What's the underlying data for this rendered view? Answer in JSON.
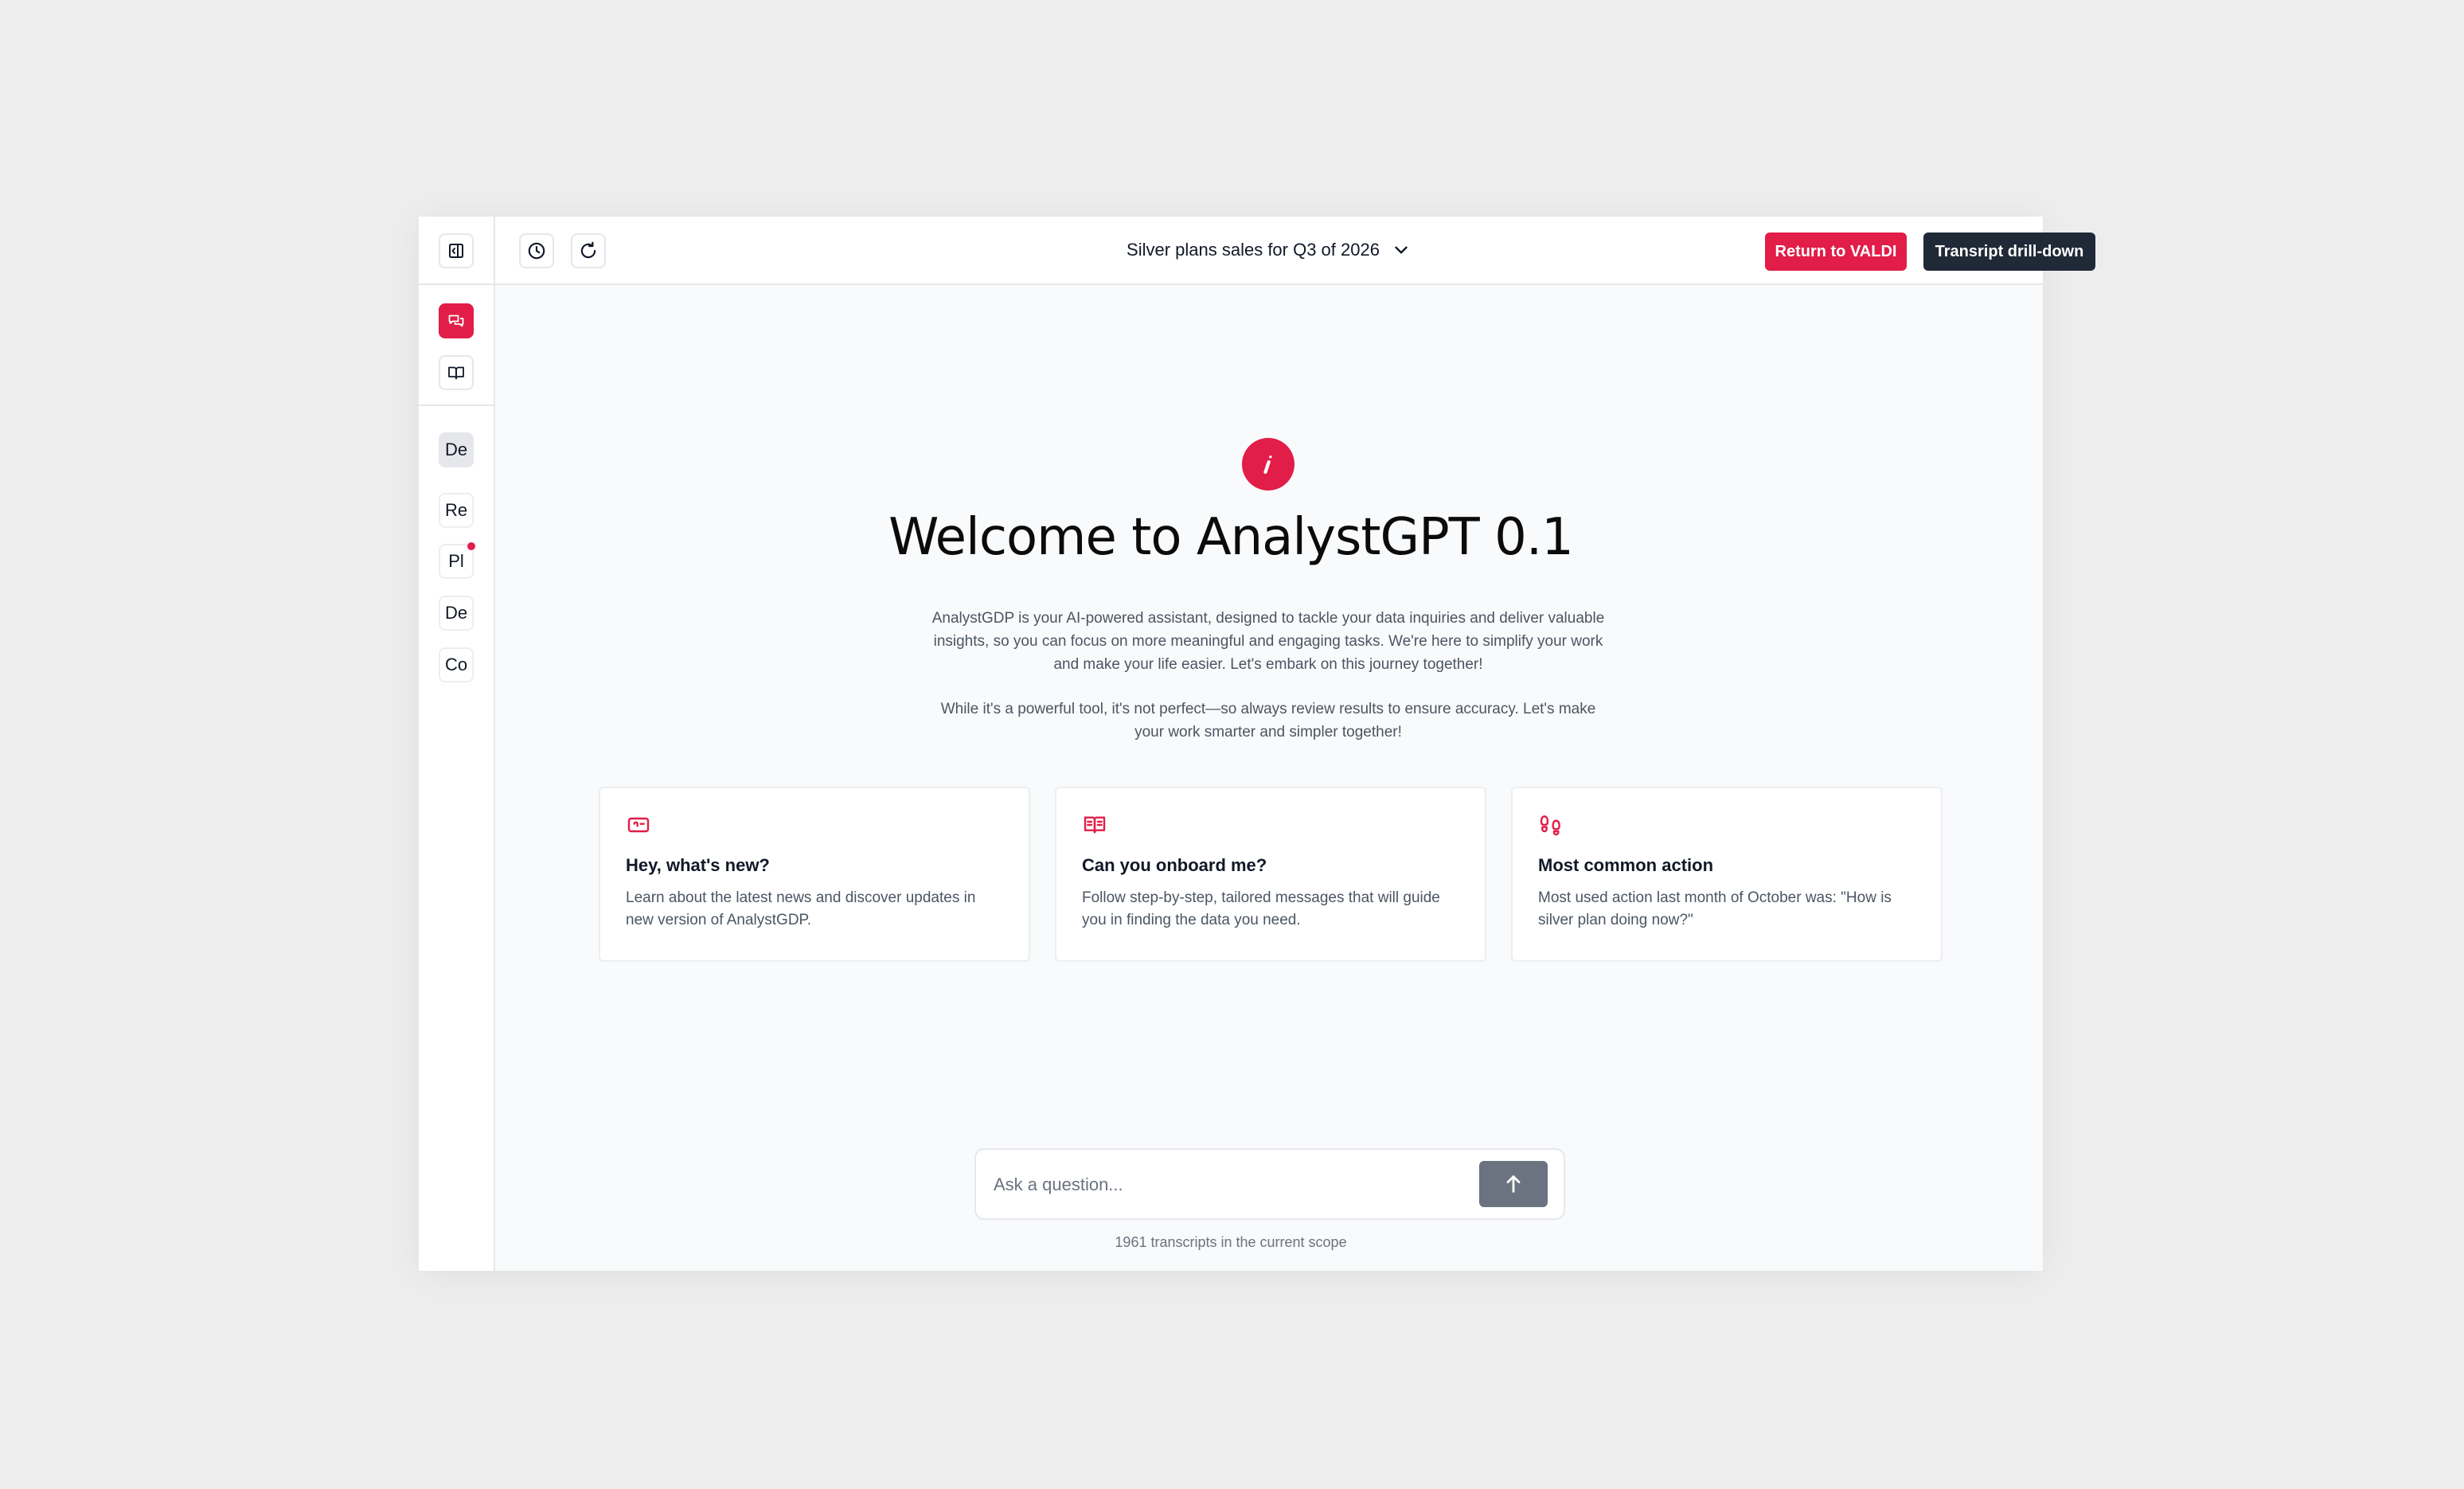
{
  "colors": {
    "accent": "#e11d48",
    "dark_button": "#1f2937",
    "send_button": "#6b7280"
  },
  "sidebar": {
    "top_icons": [
      "panel-toggle-icon",
      "chat-icon",
      "book-icon"
    ],
    "items": [
      {
        "label": "De",
        "selected": true
      },
      {
        "label": "Re"
      },
      {
        "label": "Pl",
        "notification": true
      },
      {
        "label": "De"
      },
      {
        "label": "Co"
      }
    ]
  },
  "topbar": {
    "title": "Silver plans sales for Q3 of 2026",
    "return_label": "Return to VALDI",
    "drilldown_label": "Transript drill-down"
  },
  "main": {
    "heading": "Welcome to AnalystGPT 0.1",
    "intro_1": "AnalystGDP is your AI-powered assistant, designed to tackle your data inquiries and deliver valuable insights, so you can focus on more meaningful and engaging tasks. We're here to simplify your work and make your life easier. Let's embark on this journey together!",
    "intro_2": "While it's a powerful tool, it's not perfect—so always review results to ensure accuracy. Let's make your work smarter and simpler together!",
    "cards": [
      {
        "icon": "ticket-icon",
        "title": "Hey, what's new?",
        "body": "Learn about the latest news and discover updates in new version of AnalystGDP."
      },
      {
        "icon": "open-book-icon",
        "title": "Can you onboard me?",
        "body": "Follow step-by-step, tailored messages that will guide you in finding the data you need."
      },
      {
        "icon": "footprints-icon",
        "title": "Most common action",
        "body": "Most used action last month of October was: \"How is silver plan doing now?\""
      }
    ]
  },
  "ask": {
    "placeholder": "Ask a question...",
    "footnote": "1961 transcripts in the current scope"
  }
}
